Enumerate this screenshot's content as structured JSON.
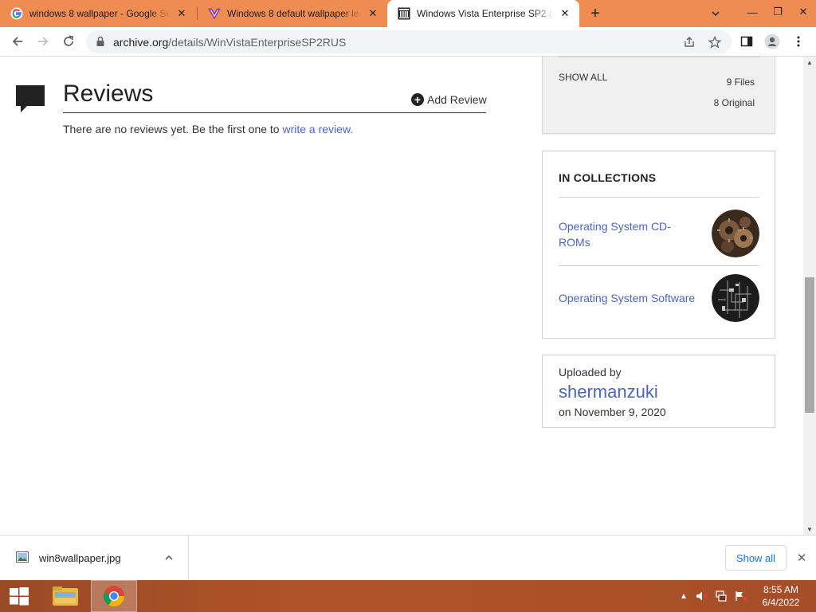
{
  "browser": {
    "tabs": [
      {
        "title": "windows 8 wallpaper - Google Se",
        "icon": "google-icon",
        "active": false
      },
      {
        "title": "Windows 8 default wallpaper lea",
        "icon": "vimeo-v-icon",
        "active": false
      },
      {
        "title": "Windows Vista Enterprise SP2 (R",
        "icon": "archive-org-icon",
        "active": true
      }
    ],
    "tab_close_glyph": "✕",
    "new_tab_glyph": "+",
    "window_controls": {
      "minimize": "—",
      "restore": "❐",
      "close": "✕"
    },
    "url_host": "archive.org",
    "url_path": "/details/WinVistaEnterpriseSP2RUS"
  },
  "page": {
    "reviews": {
      "title": "Reviews",
      "add_review": "Add Review",
      "empty_text": "There are no reviews yet. Be the first one to ",
      "write_link": "write a review."
    },
    "files": {
      "show_all": "SHOW ALL",
      "files_count": "9 Files",
      "original_count": "8 Original"
    },
    "collections": {
      "heading": "IN COLLECTIONS",
      "items": [
        {
          "label": "Operating System CD-ROMs",
          "thumb": "gears-image"
        },
        {
          "label": "Operating System Software",
          "thumb": "circuit-image"
        }
      ]
    },
    "uploader": {
      "label": "Uploaded by",
      "username": "shermanzuki",
      "date": "on November 9, 2020"
    }
  },
  "downloads": {
    "file_name": "win8wallpaper.jpg",
    "show_all": "Show all",
    "close_glyph": "✕"
  },
  "taskbar": {
    "time": "8:55 AM",
    "date": "6/4/2022"
  },
  "colors": {
    "tab_strip": "#ef8c52",
    "link": "#4b64c8",
    "taskbar": "#a54e28"
  }
}
